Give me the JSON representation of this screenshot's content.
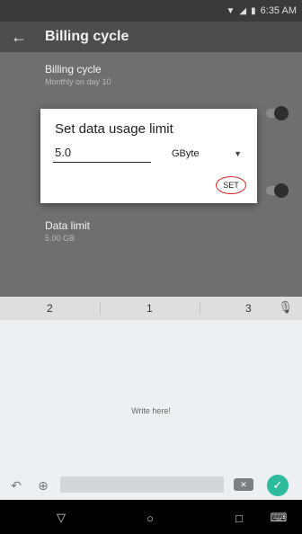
{
  "status_bar": {
    "time": "6:35 AM"
  },
  "app_bar": {
    "title": "Billing cycle",
    "back_icon": "arrow-left-icon"
  },
  "settings": {
    "billing_cycle_title": "Billing cycle",
    "billing_cycle_summary": "Monthly on day 10",
    "data_limit_title": "Data limit",
    "data_limit_summary": "5.00 GB"
  },
  "dialog": {
    "title": "Set data usage limit",
    "value": "5.0",
    "unit": "GByte",
    "set_label": "SET",
    "annotation_color": "#d82020"
  },
  "keyboard": {
    "suggestions": [
      "2",
      "1",
      "3"
    ],
    "hint": "Write here!",
    "accent_color": "#2dbb9c"
  }
}
